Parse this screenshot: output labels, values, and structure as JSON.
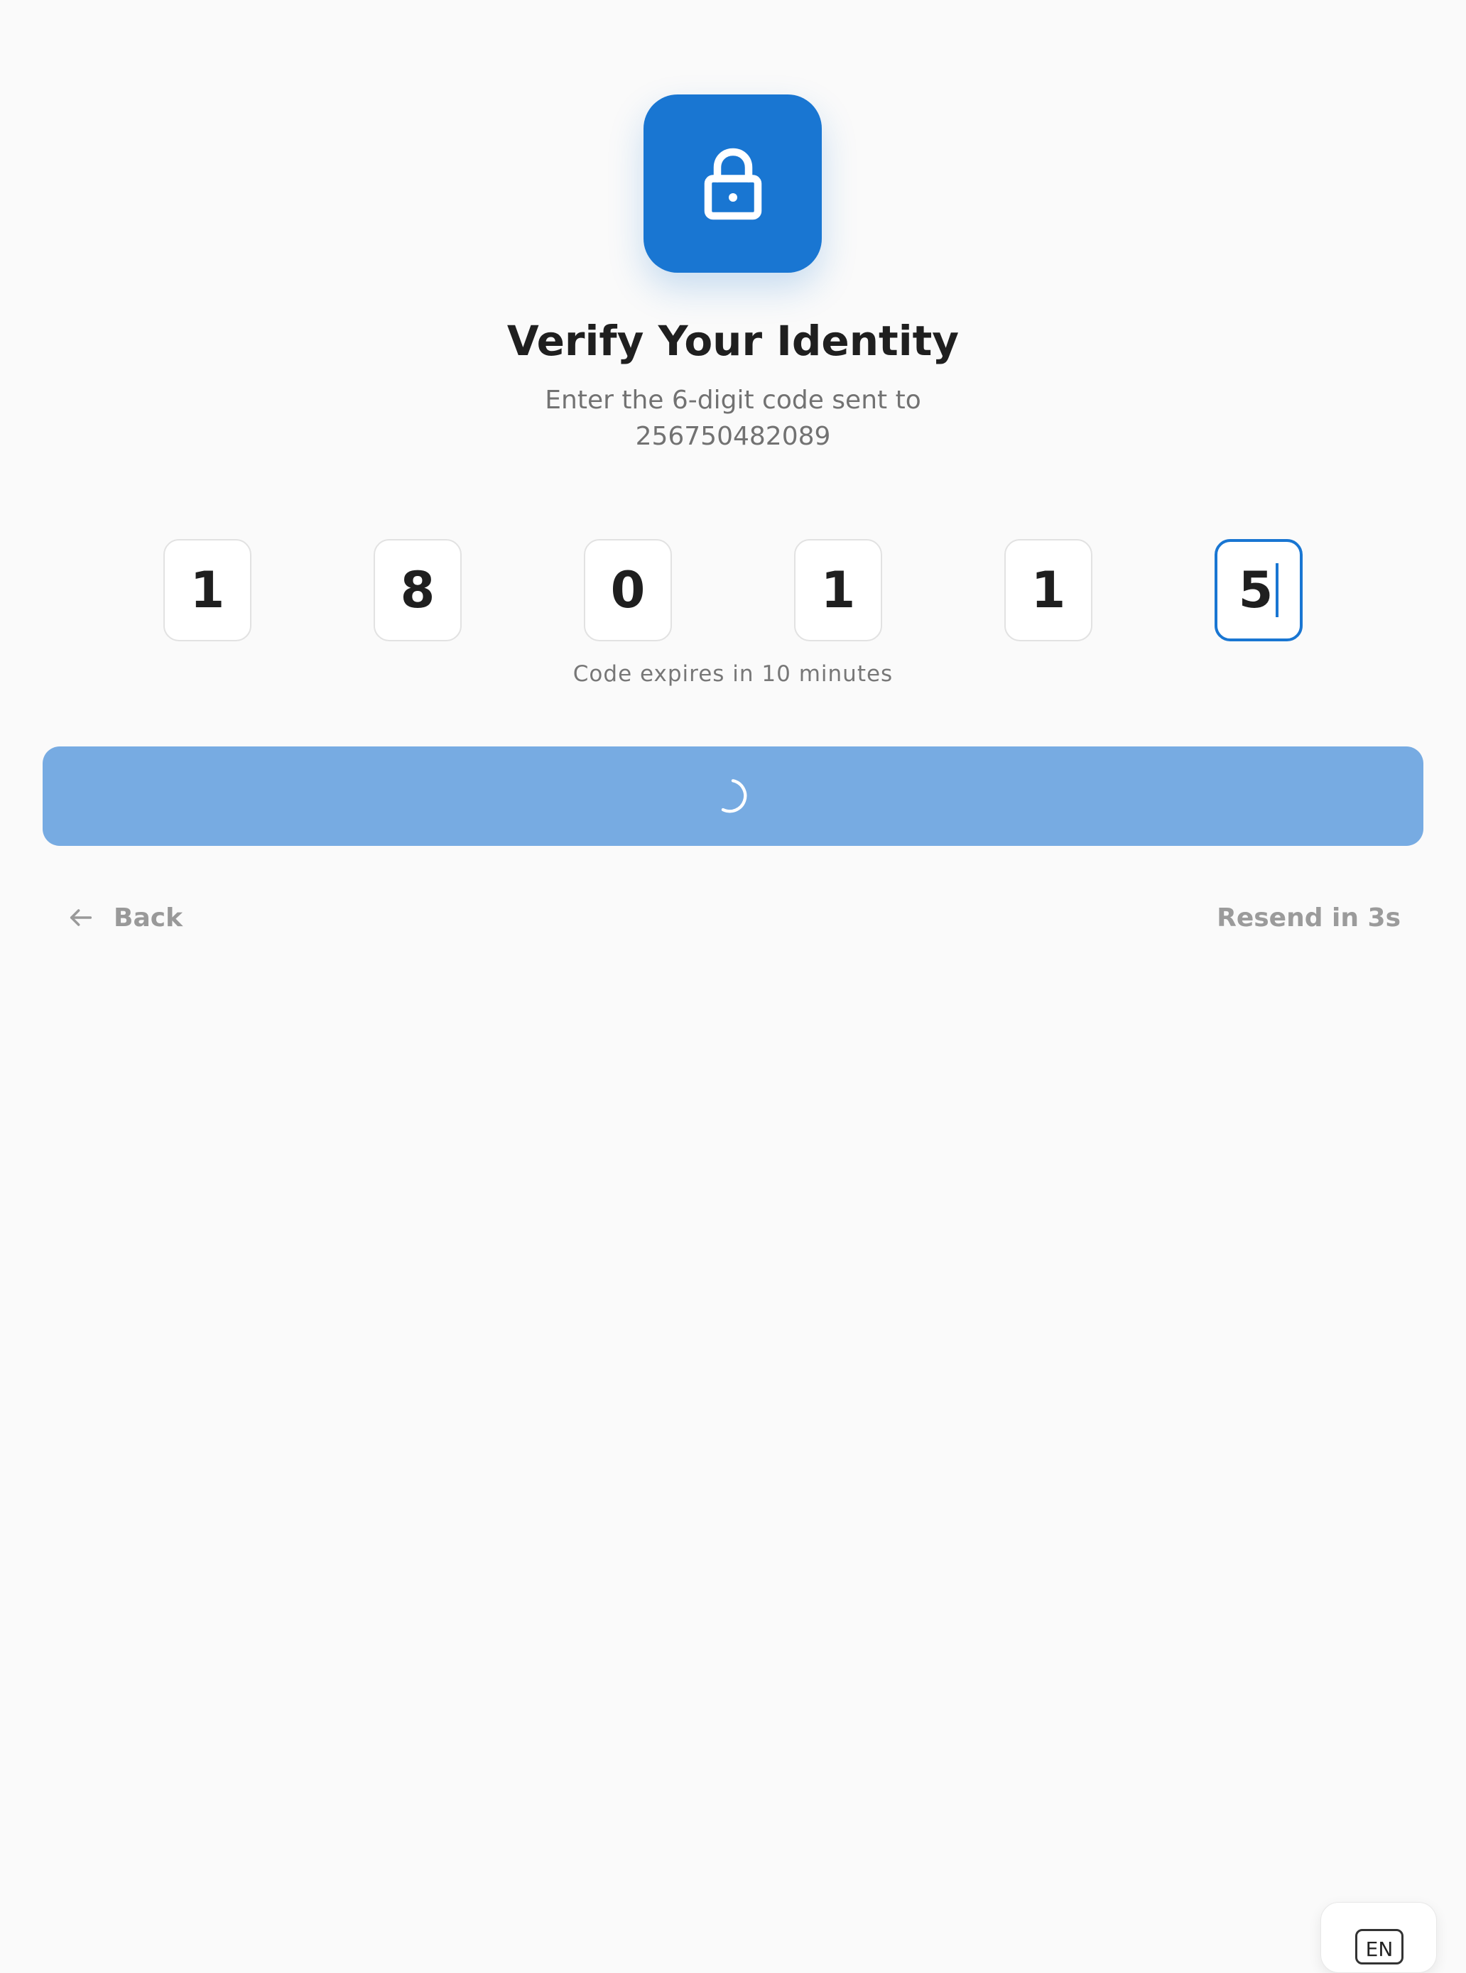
{
  "header": {
    "title": "Verify Your Identity",
    "subtitle_line1": "Enter the 6-digit code sent to",
    "subtitle_line2": "256750482089"
  },
  "code": {
    "digits": [
      "1",
      "8",
      "0",
      "1",
      "1",
      "5"
    ],
    "active_index": 5,
    "expiry_text": "Code expires in 10 minutes"
  },
  "actions": {
    "back_label": "Back",
    "resend_label": "Resend in 3s"
  },
  "language": {
    "code": "EN"
  },
  "colors": {
    "accent": "#1976d2",
    "button_loading": "#77abe2",
    "background": "#fafafa"
  },
  "icons": {
    "app_icon": "lock-icon",
    "back_icon": "arrow-left-icon",
    "submit_icon": "loading-spinner-icon"
  }
}
